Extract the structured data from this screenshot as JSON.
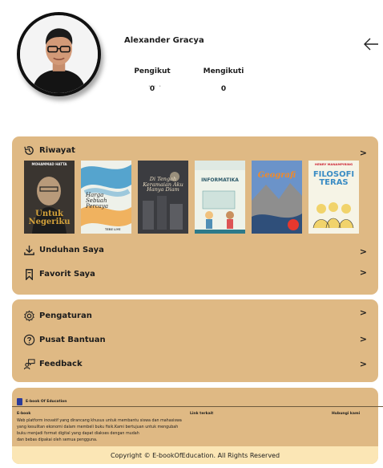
{
  "profile": {
    "name": "Alexander Gracya",
    "followers_label": "Pengikut",
    "followers_count": "0",
    "following_label": "Mengikuti",
    "following_count": "0"
  },
  "history": {
    "title": "Riwayat",
    "chevron": ">",
    "books": [
      {
        "title": "Untuk Negeriku",
        "author": "MOHAMMAD HATTA",
        "colors": [
          "#2a2a2a",
          "#d4a23a"
        ]
      },
      {
        "title": "Harga Sebuah Percaya",
        "author": "TERE LIYE",
        "colors": [
          "#e9eef0",
          "#3a97c9"
        ]
      },
      {
        "title": "Di Tengah Keramaian Aku Hanya Diam",
        "author": "",
        "colors": [
          "#3e3f44",
          "#d9c7a5"
        ]
      },
      {
        "title": "INFORMATIKA",
        "author": "",
        "colors": [
          "#eef3ea",
          "#2d7a8a"
        ]
      },
      {
        "title": "Geografi",
        "author": "",
        "colors": [
          "#3b6fb0",
          "#f08a2a"
        ]
      },
      {
        "title": "FILOSOFI TERAS",
        "author": "HENRY MANAMPIRING",
        "colors": [
          "#f3f2e6",
          "#3a8cc4"
        ]
      }
    ]
  },
  "menu": {
    "downloads": "Unduhan Saya",
    "favorites": "Favorit Saya",
    "chevron": ">"
  },
  "settings": {
    "settings_label": "Pengaturan",
    "help_label": "Pusat Bantuan",
    "feedback_label": "Feedback",
    "chevron": ">"
  },
  "footer": {
    "brand": "E-book Of Education",
    "col1": "E-book",
    "col2": "Link terkait",
    "col3": "Hubungi kami",
    "description_lines": [
      "Web platform inovatif yang dirancang khusus untuk membantu siswa dan mahasiswa",
      "yang kesulitan ekonomi dalam membeli buku fisik.Kami bertujuan untuk mengubah",
      "buku menjadi format digital yang dapat diakses dengan mudah",
      "dan bebas dipakai oleh semua pengguna."
    ],
    "copyright": "Copyright © E-bookOfEducation. All Rights Reserved"
  },
  "icons": {
    "back": "arrow-left-icon",
    "history": "history-icon",
    "download": "download-icon",
    "favorite": "bookmark-icon",
    "settings": "gear-icon",
    "help": "help-circle-icon",
    "feedback": "feedback-icon"
  },
  "colors": {
    "card": "#dfb984",
    "copyright_bar": "#fbe6b5",
    "brand": "#2b3b9a"
  }
}
